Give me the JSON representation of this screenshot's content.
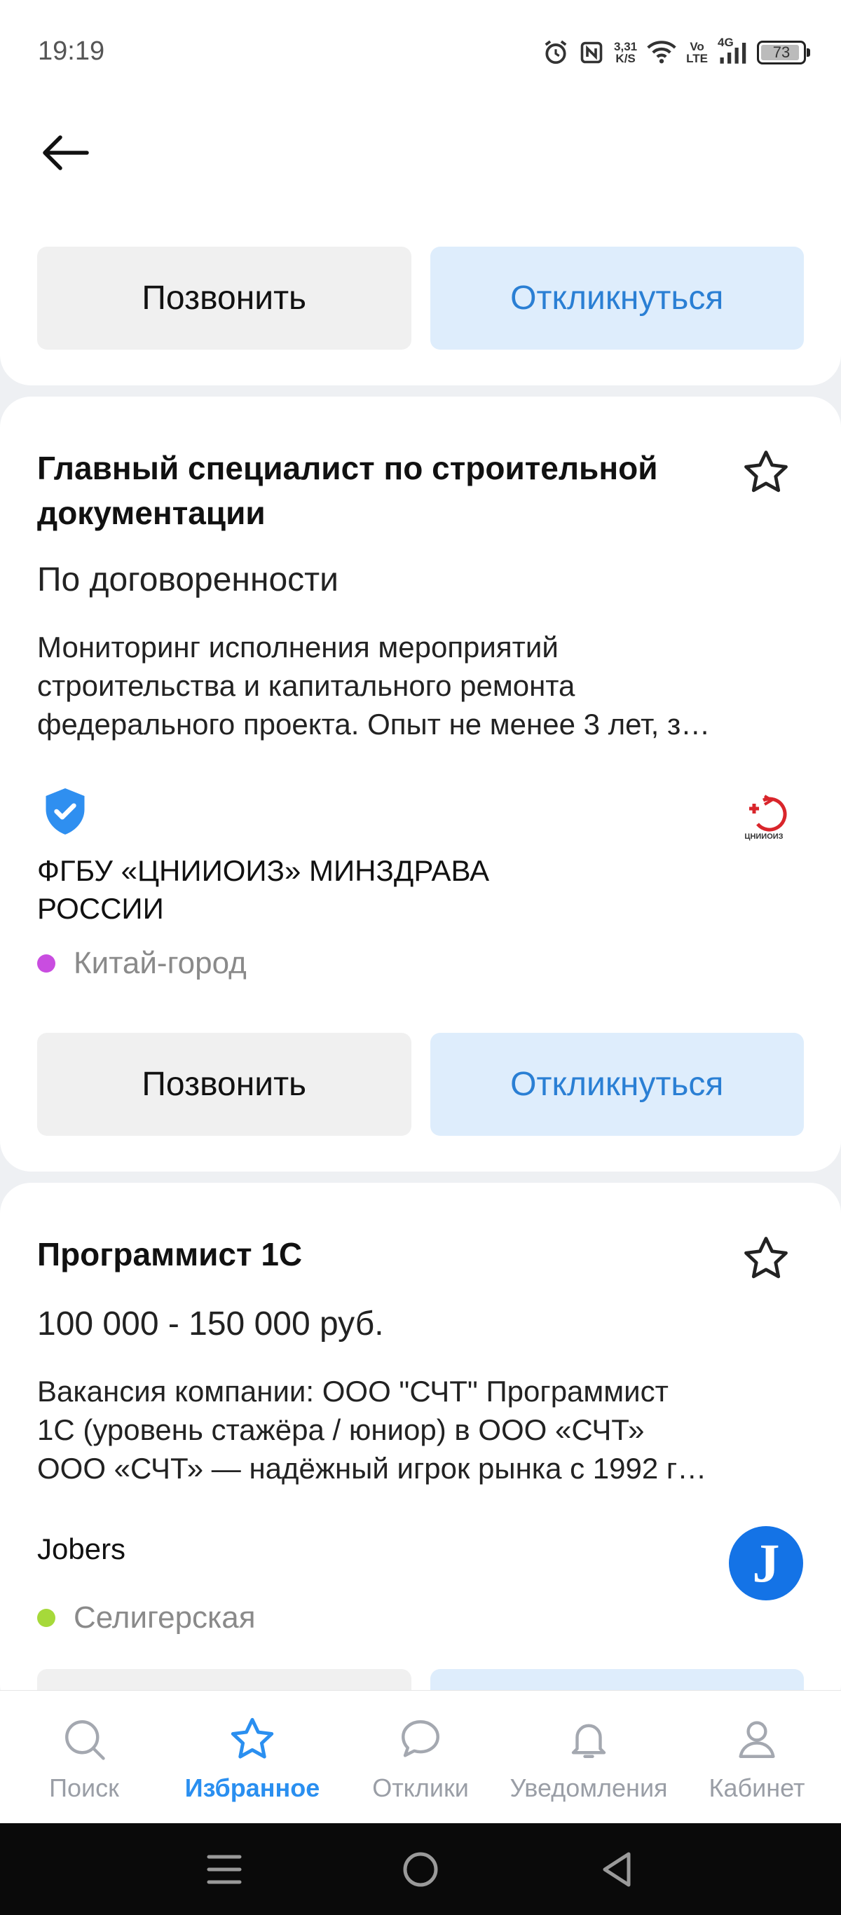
{
  "status": {
    "time": "19:19",
    "net_speed_value": "3,31",
    "net_speed_unit": "K/S",
    "volte_top": "Vo",
    "volte_bottom": "LTE",
    "network": "4G",
    "battery": "73"
  },
  "top_card": {
    "call_label": "Позвонить",
    "respond_label": "Откликнуться"
  },
  "vacancies": [
    {
      "title": "Главный специалист по строительной документации",
      "salary": "По договоренности",
      "description_lines": [
        "Мониторинг исполнения мероприятий",
        "строительства и капитального ремонта",
        "федерального проекта. Опыт не менее 3 лет, з…"
      ],
      "company": "ФГБУ «ЦНИИОИЗ» МИНЗДРАВА РОССИИ",
      "logo_text": "ЦНИИОИЗ",
      "metro": "Китай-город",
      "metro_color": "#c94de0",
      "call_label": "Позвонить",
      "respond_label": "Откликнуться"
    },
    {
      "title": "Программист 1С",
      "salary": "100 000 - 150 000 руб.",
      "description_lines": [
        "Вакансия компании: ООО \"СЧТ\" Программист",
        "1С (уровень стажёра / юниор) в ООО «СЧТ»",
        "ООО «СЧТ» — надёжный игрок рынка с 1992 г…"
      ],
      "company": "Jobers",
      "logo_text": "J",
      "metro": "Селигерская",
      "metro_color": "#a6d93a"
    }
  ],
  "bottom_nav": {
    "items": [
      {
        "label": "Поиск",
        "icon": "search-icon"
      },
      {
        "label": "Избранное",
        "icon": "star-icon"
      },
      {
        "label": "Отклики",
        "icon": "chat-bubble-icon"
      },
      {
        "label": "Уведомления",
        "icon": "bell-icon"
      },
      {
        "label": "Кабинет",
        "icon": "profile-icon"
      }
    ],
    "active_index": 1,
    "active_color": "#2a8ff0"
  },
  "colors": {
    "accent": "#2a7fd4",
    "respond_bg": "#deedfc",
    "call_bg": "#f0f0f0",
    "verified_badge": "#2f8ff0",
    "jobers_logo": "#1473e6"
  }
}
